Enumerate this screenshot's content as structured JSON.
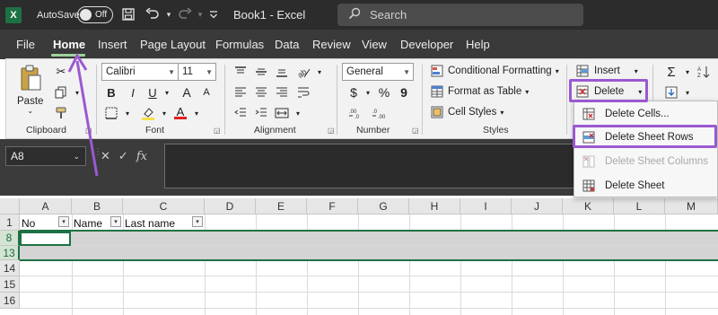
{
  "titlebar": {
    "app_logo": "X",
    "autosave_label": "AutoSave",
    "autosave_state": "Off",
    "doc_title": "Book1  -  Excel",
    "search_placeholder": "Search",
    "icons": [
      "save-icon",
      "undo-icon",
      "redo-icon",
      "customize-qat-icon"
    ]
  },
  "menu": {
    "items": [
      "File",
      "Home",
      "Insert",
      "Page Layout",
      "Formulas",
      "Data",
      "Review",
      "View",
      "Developer",
      "Help"
    ],
    "active": "Home"
  },
  "ribbon": {
    "clipboard": {
      "label": "Clipboard",
      "paste_label": "Paste"
    },
    "font": {
      "label": "Font",
      "font_name": "Calibri",
      "font_size": "11",
      "bold": "B",
      "italic": "I",
      "underline": "U",
      "grow": "A",
      "shrink": "A",
      "font_color_glyph": "A"
    },
    "alignment": {
      "label": "Alignment"
    },
    "number": {
      "label": "Number",
      "format": "General",
      "currency": "$",
      "percent": "%",
      "comma": "9"
    },
    "styles": {
      "label": "Styles",
      "conditional": "Conditional Formatting",
      "format_table": "Format as Table",
      "cell_styles": "Cell Styles"
    },
    "cells": {
      "insert": "Insert",
      "delete": "Delete"
    },
    "editing": {
      "sum": "Σ"
    }
  },
  "dropdown": {
    "items": [
      {
        "label": "Delete Cells...",
        "icon": "delete-cells-icon",
        "disabled": false
      },
      {
        "label": "Delete Sheet Rows",
        "icon": "delete-rows-icon",
        "disabled": false
      },
      {
        "label": "Delete Sheet Columns",
        "icon": "delete-columns-icon",
        "disabled": true
      },
      {
        "label": "Delete Sheet",
        "icon": "delete-sheet-icon",
        "disabled": false
      }
    ]
  },
  "formula_bar": {
    "name_box": "A8",
    "fx": "fx",
    "cancel": "✕",
    "enter": "✓"
  },
  "sheet": {
    "columns": [
      "A",
      "B",
      "C",
      "D",
      "E",
      "F",
      "G",
      "H",
      "I",
      "J",
      "K",
      "L",
      "M"
    ],
    "rows": [
      "1",
      "8",
      "13",
      "14",
      "15",
      "16"
    ],
    "selected_rows": [
      "8",
      "13"
    ],
    "header_cells": [
      "No",
      "Name",
      "Last name"
    ]
  },
  "colors": {
    "accent": "#1e7145",
    "highlight": "#9b59d0",
    "titlebar": "#2c2c2c"
  }
}
